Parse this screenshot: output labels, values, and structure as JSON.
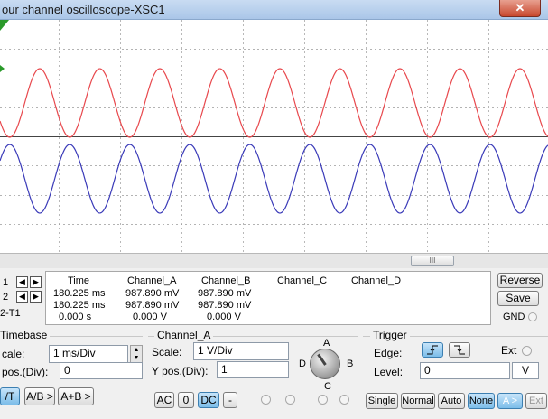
{
  "window": {
    "title": "our channel oscilloscope-XSC1",
    "close_icon": "✕"
  },
  "colors": {
    "channel_a_trace": "#e8484d",
    "channel_b_trace": "#3a3ab8",
    "grid": "#9a9a9a",
    "trigger_marker": "#2a9a2a"
  },
  "scrollbar": {
    "thumb_glyph": "III"
  },
  "cursors": {
    "row1": "1",
    "row2": "2",
    "diff": "2-T1"
  },
  "readout": {
    "headers": [
      "Time",
      "Channel_A",
      "Channel_B",
      "Channel_C",
      "Channel_D"
    ],
    "t1": [
      "180.225 ms",
      "987.890 mV",
      "987.890 mV"
    ],
    "t2": [
      "180.225 ms",
      "987.890 mV",
      "987.890 mV"
    ],
    "diff": [
      "0.000 s",
      "0.000 V",
      "0.000 V"
    ]
  },
  "side_buttons": {
    "reverse": "Reverse",
    "save": "Save",
    "gnd": "GND"
  },
  "timebase": {
    "title": "Timebase",
    "scale_label": "cale:",
    "scale_value": "1 ms/Div",
    "xpos_label": "pos.(Div):",
    "xpos_value": "0",
    "modes": [
      "/T",
      "A/B >",
      "A+B >"
    ]
  },
  "channel_a": {
    "title": "Channel_A",
    "scale_label": "Scale:",
    "scale_value": "1  V/Div",
    "ypos_label": "Y pos.(Div):",
    "ypos_value": "1",
    "coupling": [
      "AC",
      "0",
      "DC",
      "-"
    ]
  },
  "channel_selector": {
    "a": "A",
    "b": "B",
    "c": "C",
    "d": "D"
  },
  "trigger": {
    "title": "Trigger",
    "edge_label": "Edge:",
    "ext_label": "Ext",
    "level_label": "Level:",
    "level_value": "0",
    "level_unit": "V",
    "modes": [
      "Single",
      "Normal",
      "Auto",
      "None",
      "A >",
      "Ext"
    ]
  }
}
